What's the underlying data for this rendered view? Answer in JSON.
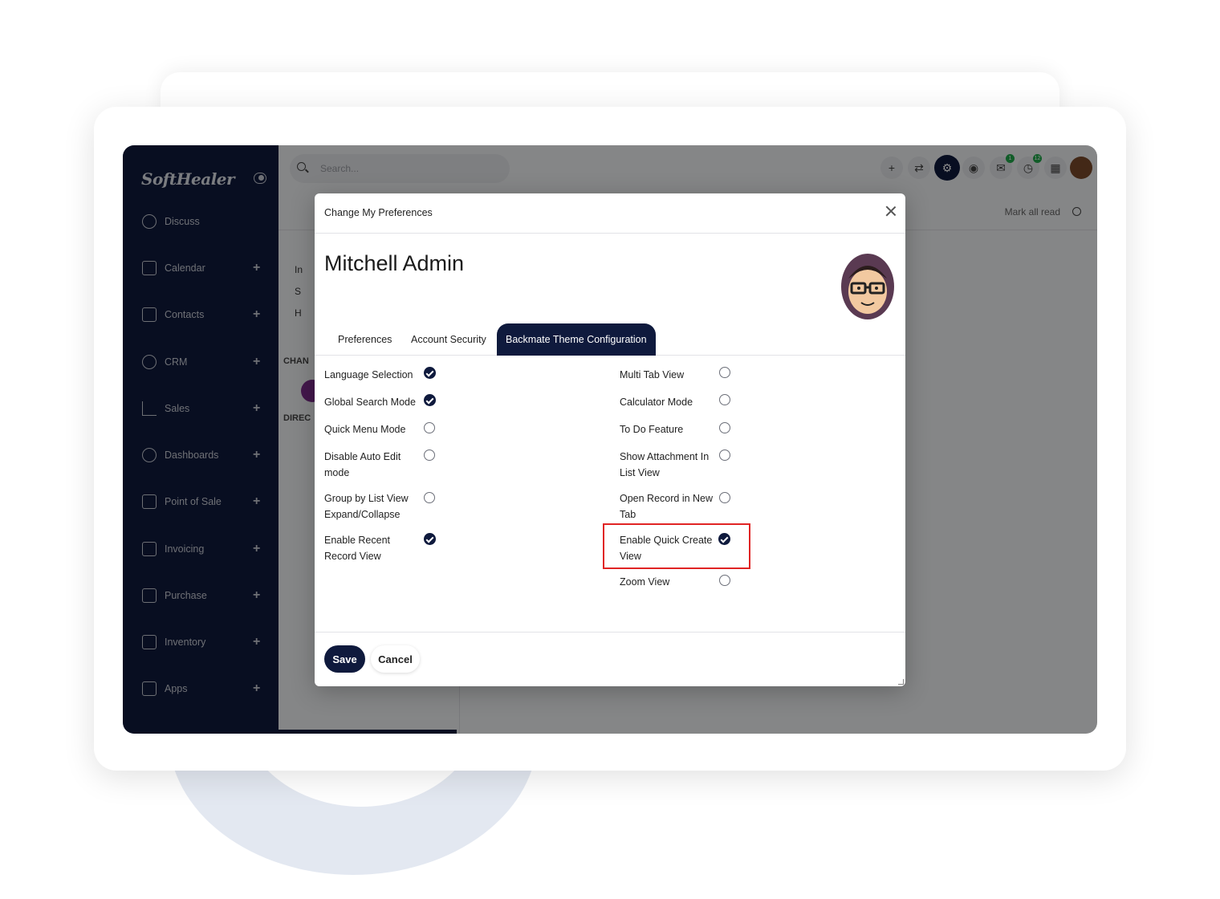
{
  "app": {
    "logo_text": "SoftHealer",
    "search_placeholder": "Search..."
  },
  "sidebar": {
    "items": [
      {
        "label": "Discuss",
        "icon": "chat-icon",
        "has_plus": false
      },
      {
        "label": "Calendar",
        "icon": "calendar-icon",
        "has_plus": true
      },
      {
        "label": "Contacts",
        "icon": "contacts-icon",
        "has_plus": true
      },
      {
        "label": "CRM",
        "icon": "handshake-icon",
        "has_plus": true
      },
      {
        "label": "Sales",
        "icon": "chart-icon",
        "has_plus": true
      },
      {
        "label": "Dashboards",
        "icon": "gauge-icon",
        "has_plus": true
      },
      {
        "label": "Point of Sale",
        "icon": "store-icon",
        "has_plus": true
      },
      {
        "label": "Invoicing",
        "icon": "receipt-icon",
        "has_plus": true
      },
      {
        "label": "Purchase",
        "icon": "card-icon",
        "has_plus": true
      },
      {
        "label": "Inventory",
        "icon": "box-icon",
        "has_plus": true
      },
      {
        "label": "Apps",
        "icon": "cubes-icon",
        "has_plus": true
      }
    ],
    "plus_symbol": "+"
  },
  "topbar": {
    "badges": [
      "1",
      "12"
    ]
  },
  "subbar": {
    "mark_all_read": "Mark all read"
  },
  "side_panel": {
    "rows": [
      "In",
      "S",
      "H"
    ],
    "heading_1": "CHAN",
    "heading_2": "DIREC"
  },
  "modal": {
    "title": "Change My Preferences",
    "user_name": "Mitchell Admin",
    "tabs": [
      "Preferences",
      "Account Security",
      "Backmate Theme Configuration"
    ],
    "active_tab": "Backmate Theme Configuration",
    "left_options": [
      {
        "label": "Language Selection",
        "checked": true
      },
      {
        "label": "Global Search Mode",
        "checked": true
      },
      {
        "label": "Quick Menu Mode",
        "checked": false
      },
      {
        "label": "Disable Auto Edit mode",
        "checked": false
      },
      {
        "label": "Group by List View Expand/Collapse",
        "checked": false
      },
      {
        "label": "Enable Recent Record View",
        "checked": true
      }
    ],
    "right_options": [
      {
        "label": "Multi Tab View",
        "checked": false
      },
      {
        "label": "Calculator Mode",
        "checked": false
      },
      {
        "label": "To Do Feature",
        "checked": false
      },
      {
        "label": "Show Attachment In List View",
        "checked": false
      },
      {
        "label": "Open Record in New Tab",
        "checked": false
      },
      {
        "label": "Enable Quick Create View",
        "checked": true
      },
      {
        "label": "Zoom View",
        "checked": false
      }
    ],
    "save_label": "Save",
    "cancel_label": "Cancel"
  },
  "colors": {
    "navy": "#0f1a3d",
    "highlight": "#e02424",
    "badge_green": "#1fa84a"
  }
}
